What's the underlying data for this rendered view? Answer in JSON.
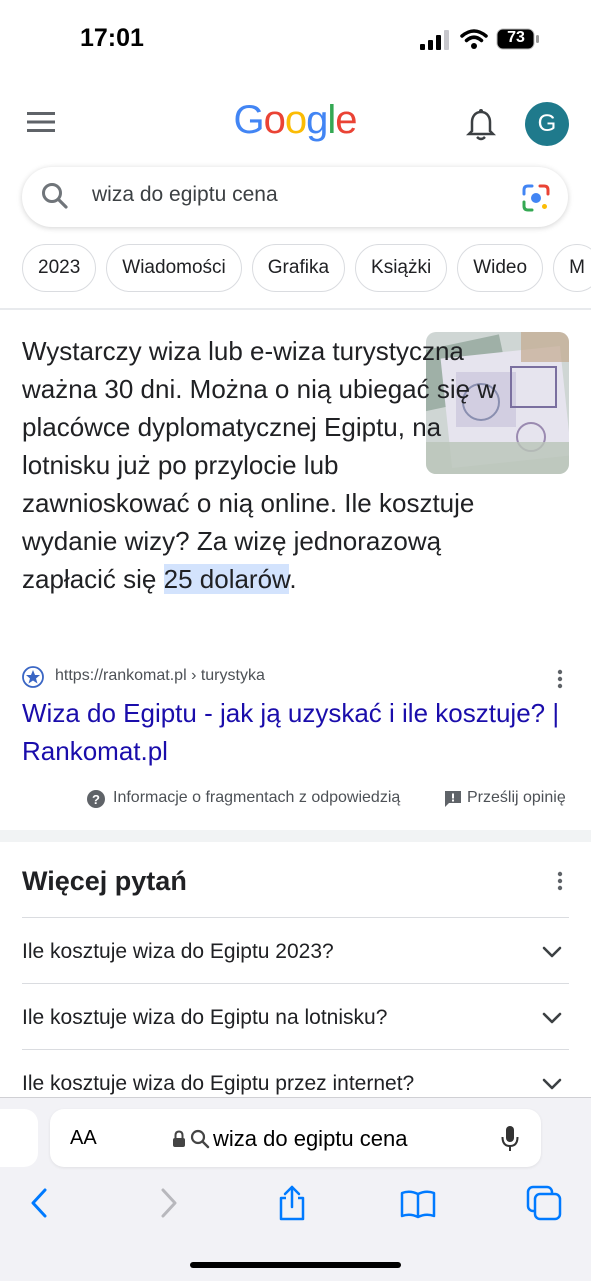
{
  "status_bar": {
    "time": "17:01",
    "battery": "73"
  },
  "header": {
    "logo": "Google",
    "avatar_letter": "G"
  },
  "search": {
    "query": "wiza do egiptu cena"
  },
  "chips": [
    "2023",
    "Wiadomości",
    "Grafika",
    "Książki",
    "Wideo",
    "M"
  ],
  "snippet": {
    "text_before": "Wystarczy wiza lub e-wiza turystyczna ważna 30 dni. Można o nią ubiegać się w placówce dyplomatycznej Egiptu, na lotnisku już po przylocie lub zawnioskować o nią online. Ile kosztuje wydanie wizy? Za wizę jednorazową zapłacić się ",
    "highlight": "25 dolarów",
    "text_after": ".",
    "source_url": "https://rankomat.pl › turystyka",
    "result_title": "Wiza do Egiptu - jak ją uzyskać i ile kosztuje? | Rankomat.pl",
    "info_label": "Informacje o fragmentach z odpowiedzią",
    "feedback_label": "Prześlij opinię"
  },
  "more_questions": {
    "title": "Więcej pytań",
    "items": [
      "Ile kosztuje wiza do Egiptu 2023?",
      "Ile kosztuje wiza do Egiptu na lotnisku?",
      "Ile kosztuje wiza do Egiptu przez internet?"
    ]
  },
  "safari": {
    "aa_label": "AA",
    "address": "wiza do egiptu cena"
  },
  "colors": {
    "link": "#1a0dab",
    "highlight": "#d3e3fd",
    "avatar": "#1f7a8c",
    "accent": "#007aff"
  }
}
